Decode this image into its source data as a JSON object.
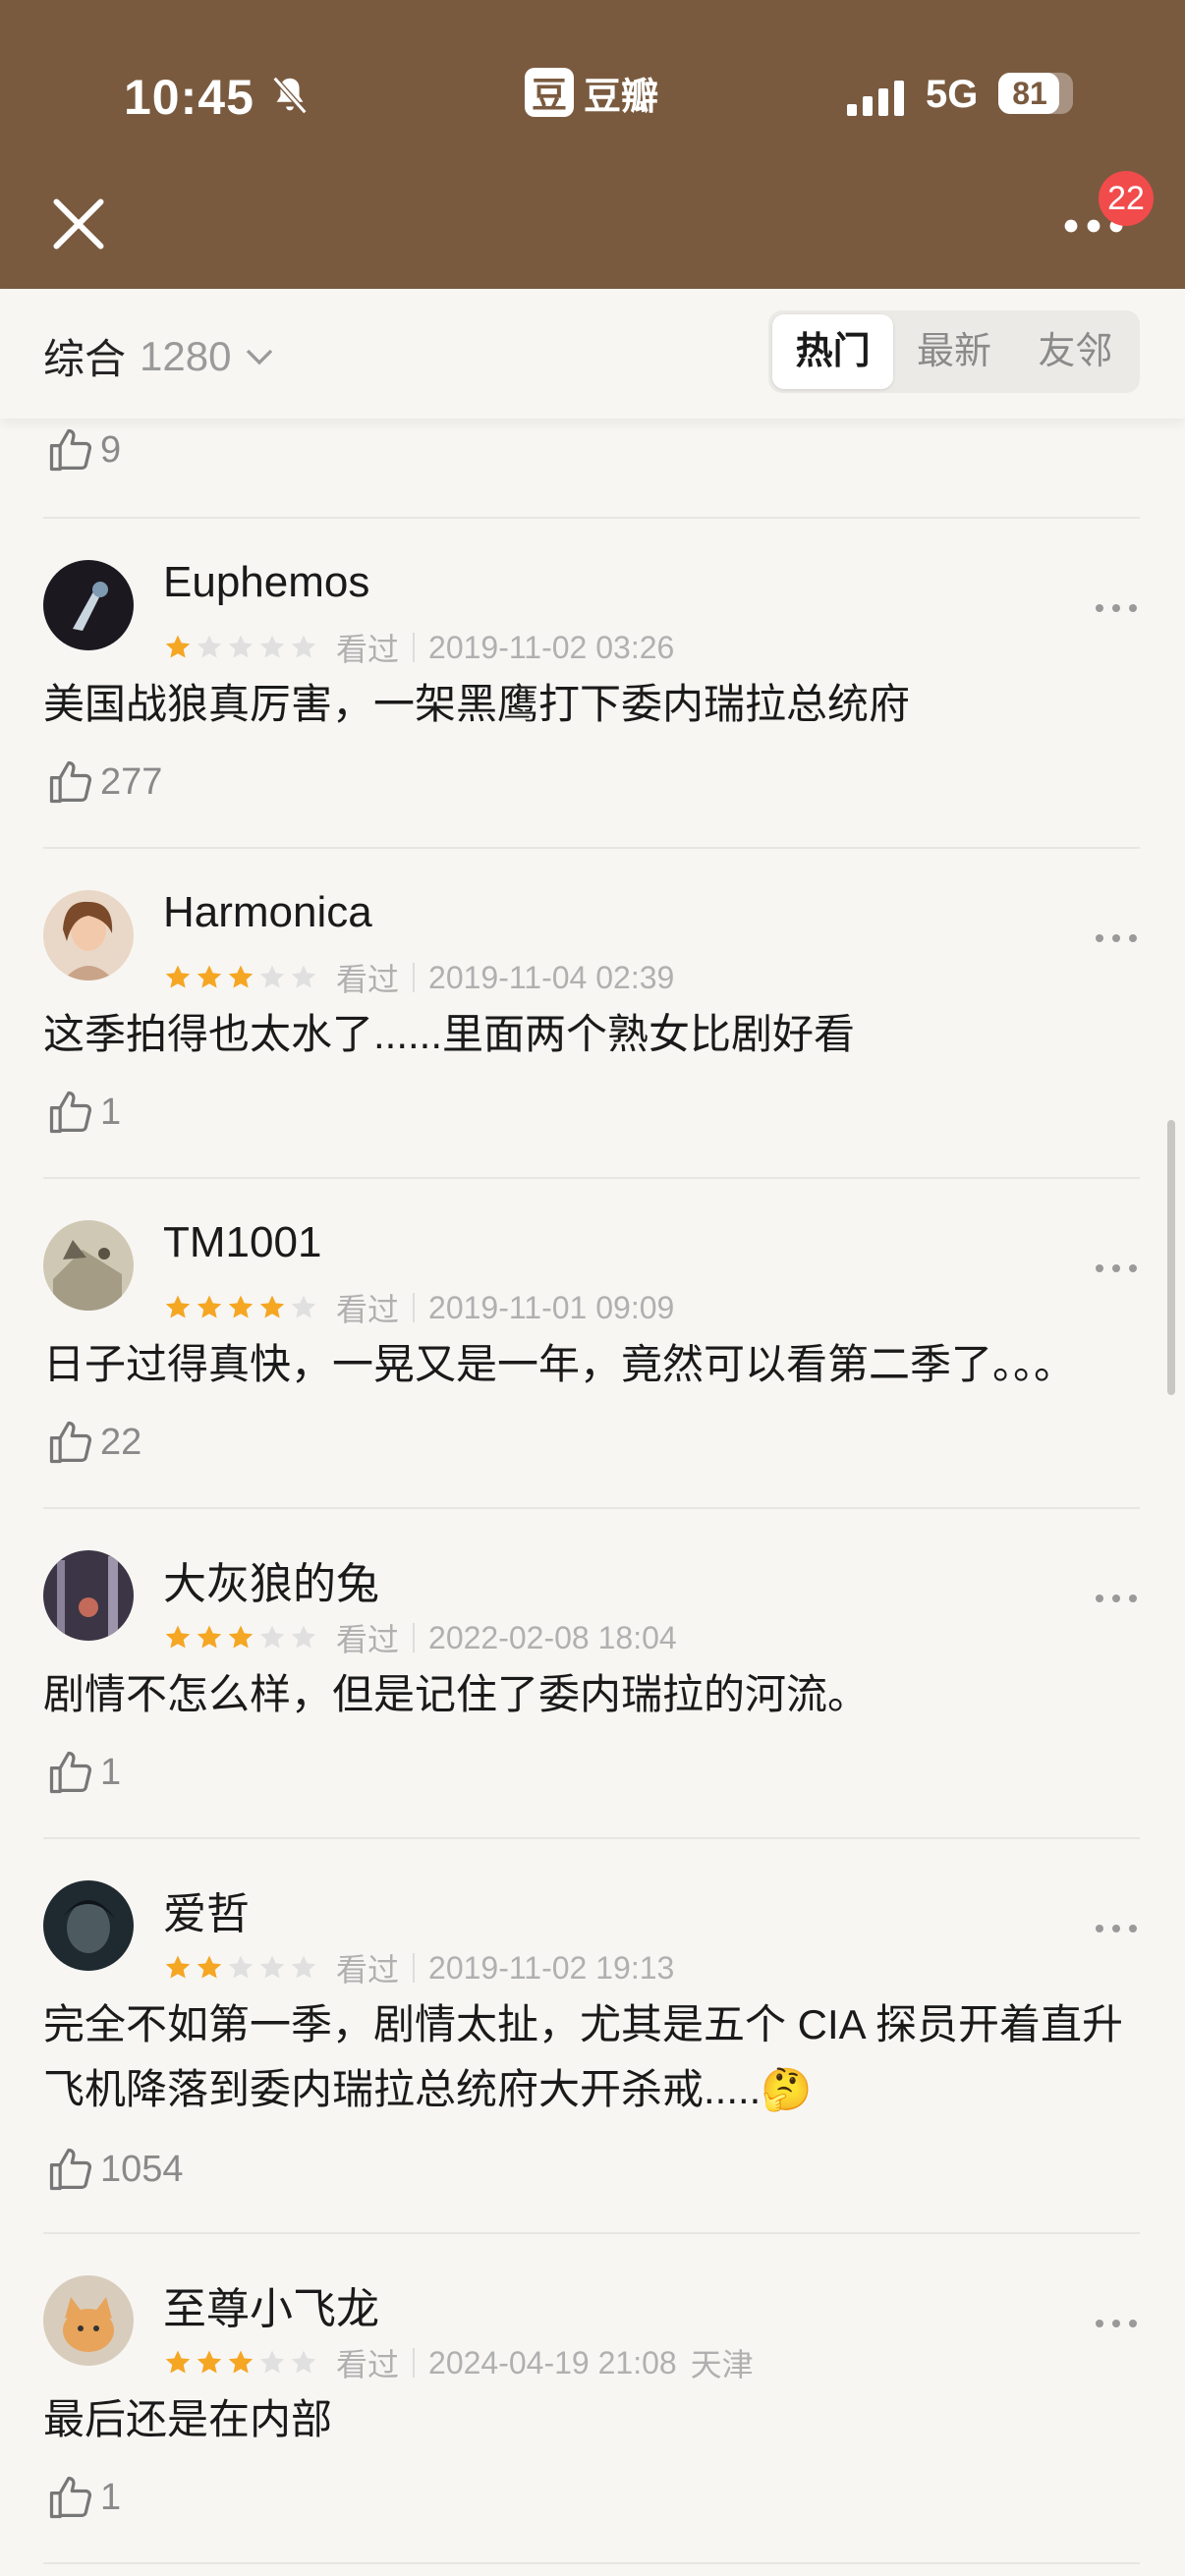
{
  "status_bar": {
    "time": "10:45",
    "network": "5G",
    "battery": "81",
    "battery_level": 0.81
  },
  "app": {
    "badge": "豆",
    "name": "豆瓣"
  },
  "header": {
    "notification_count": "22"
  },
  "filter": {
    "sort_label": "综合",
    "count": "1280",
    "tabs": [
      "热门",
      "最新",
      "友邻"
    ],
    "active_tab": 0
  },
  "first_like": "9",
  "colors": {
    "header_bg": "#7a5a3f",
    "star_on": "#f5a623",
    "star_off": "#e0e0e0",
    "badge_red": "#f24b4b"
  },
  "reviews": [
    {
      "name": "Euphemos",
      "stars": 1,
      "status": "看过",
      "date": "2019-11-02 03:26",
      "text": "美国战狼真厉害，一架黑鹰打下委内瑞拉总统府",
      "likes": "277"
    },
    {
      "name": "Harmonica",
      "stars": 3,
      "status": "看过",
      "date": "2019-11-04 02:39",
      "text": "这季拍得也太水了......里面两个熟女比剧好看",
      "likes": "1"
    },
    {
      "name": "TM1001",
      "stars": 4,
      "status": "看过",
      "date": "2019-11-01 09:09",
      "text": "日子过得真快，一晃又是一年，竟然可以看第二季了。。。",
      "likes": "22"
    },
    {
      "name": "大灰狼的兔",
      "stars": 3,
      "status": "看过",
      "date": "2022-02-08 18:04",
      "text": "剧情不怎么样，但是记住了委内瑞拉的河流。",
      "likes": "1"
    },
    {
      "name": "爱哲",
      "stars": 2,
      "status": "看过",
      "date": "2019-11-02 19:13",
      "text": "完全不如第一季，剧情太扯，尤其是五个 CIA 探员开着直升飞机降落到委内瑞拉总统府大开杀戒.....🤔",
      "likes": "1054"
    },
    {
      "name": "至尊小飞龙",
      "stars": 3,
      "status": "看过",
      "date": "2024-04-19 21:08",
      "location": "天津",
      "text": "最后还是在内部",
      "likes": "1"
    }
  ]
}
